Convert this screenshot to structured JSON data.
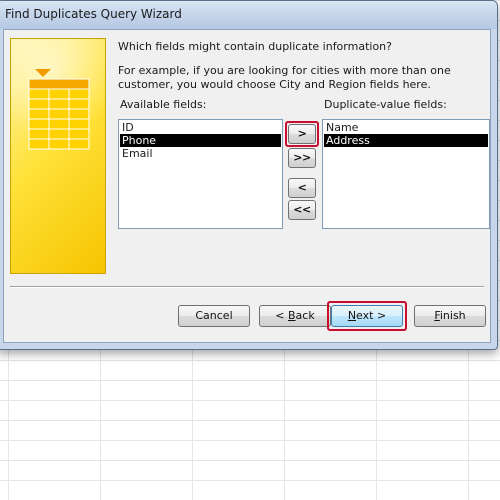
{
  "window": {
    "title": "Find Duplicates Query Wizard"
  },
  "wizard": {
    "question": "Which fields might contain duplicate information?",
    "example": "For example, if you are looking for cities with more than one customer, you would choose City and Region fields here.",
    "available_label": "Available fields:",
    "duplicate_label": "Duplicate-value fields:"
  },
  "available_fields": [
    {
      "label": "ID",
      "selected": false
    },
    {
      "label": "Phone",
      "selected": true
    },
    {
      "label": "Email",
      "selected": false
    }
  ],
  "duplicate_fields": [
    {
      "label": "Name",
      "selected": false
    },
    {
      "label": "Address",
      "selected": true
    }
  ],
  "move_buttons": {
    "add": ">",
    "add_all": ">>",
    "remove": "<",
    "remove_all": "<<"
  },
  "footer": {
    "cancel": "Cancel",
    "back_mnemonic": "<",
    "back_rest": " Back",
    "back_b": "B",
    "back_tail": "ack",
    "next_mnemonic": "N",
    "next_rest": "ext >",
    "finish_mnemonic": "F",
    "finish_rest": "inish"
  },
  "colors": {
    "highlight": "#c8102e",
    "selection": "#000000",
    "banner": "#ffe23a"
  },
  "icons": {
    "banner": "table-grid-icon"
  }
}
